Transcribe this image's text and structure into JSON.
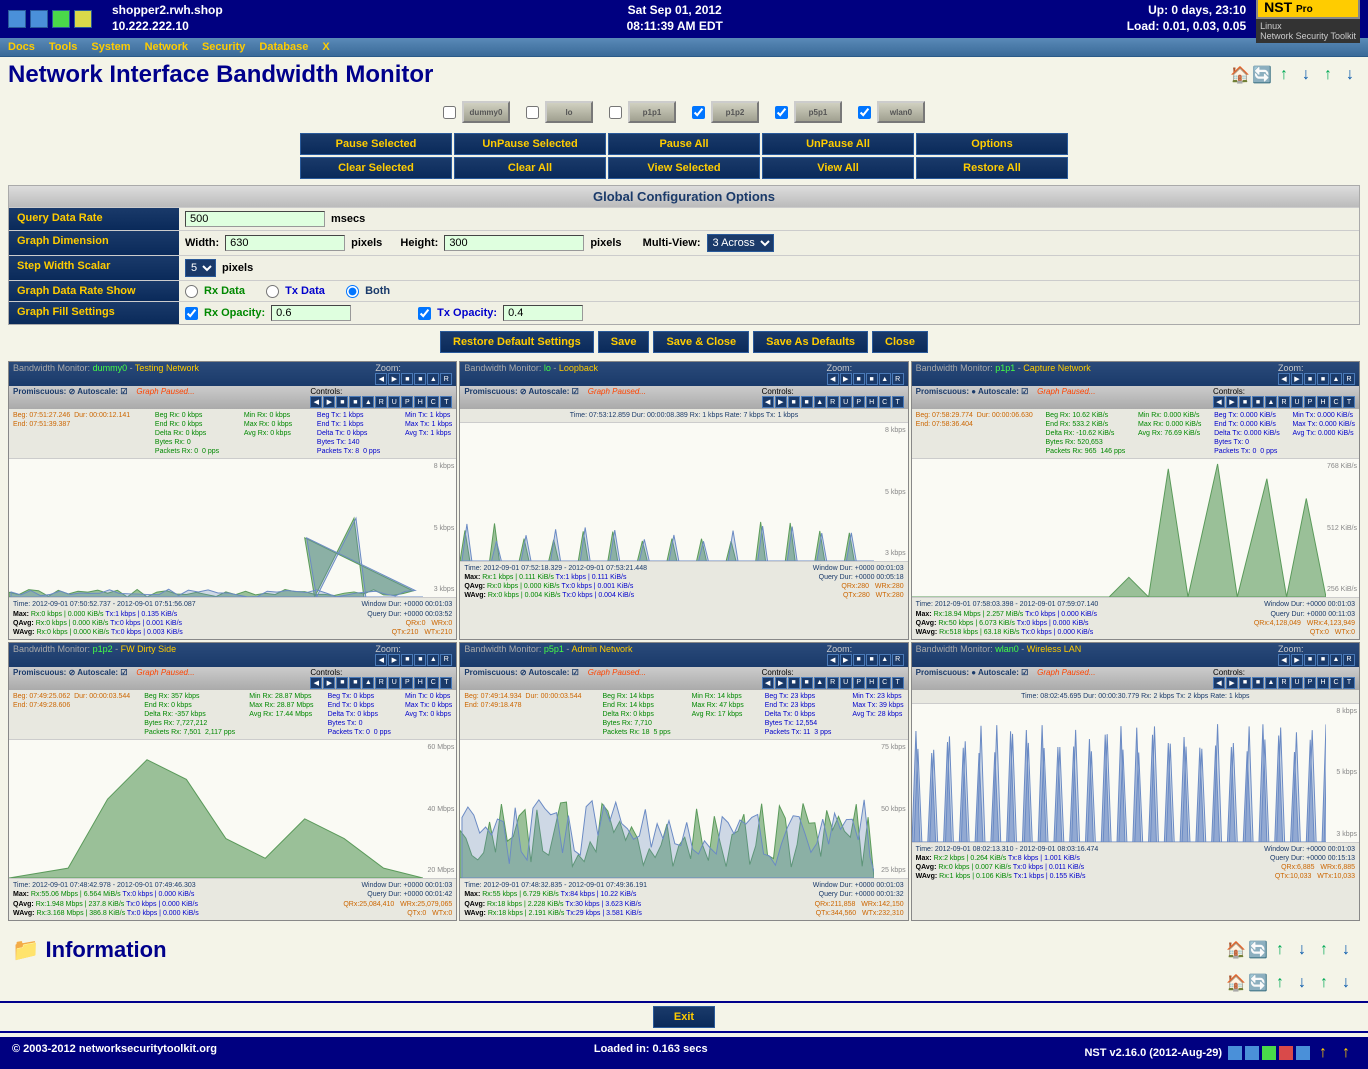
{
  "header": {
    "hostname": "shopper2.rwh.shop",
    "ip": "10.222.222.10",
    "date": "Sat Sep 01, 2012",
    "time": "08:11:39 AM EDT",
    "uptime": "Up: 0 days, 23:10",
    "load": "Load: 0.01, 0.03, 0.05",
    "logo": "NST",
    "logo_sub": "Pro",
    "os": "Linux",
    "os_sub": "Network Security Toolkit"
  },
  "menu": [
    "Docs",
    "Tools",
    "System",
    "Network",
    "Security",
    "Database",
    "X"
  ],
  "page_title": "Network Interface Bandwidth Monitor",
  "interfaces": [
    {
      "name": "dummy0",
      "checked": false
    },
    {
      "name": "lo",
      "checked": false
    },
    {
      "name": "p1p1",
      "checked": false
    },
    {
      "name": "p1p2",
      "checked": true
    },
    {
      "name": "p5p1",
      "checked": true
    },
    {
      "name": "wlan0",
      "checked": true
    }
  ],
  "action_buttons": {
    "row1": [
      "Pause Selected",
      "UnPause Selected",
      "Pause All",
      "UnPause All",
      "Options"
    ],
    "row2": [
      "Clear Selected",
      "Clear All",
      "View Selected",
      "View All",
      "Restore All"
    ]
  },
  "config": {
    "title": "Global Configuration Options",
    "query_label": "Query Data Rate",
    "query_value": "500",
    "query_unit": "msecs",
    "dimension_label": "Graph Dimension",
    "width_label": "Width:",
    "width_value": "630",
    "height_label": "Height:",
    "height_value": "300",
    "pixels": "pixels",
    "multiview_label": "Multi-View:",
    "multiview_value": "3 Across",
    "stepwidth_label": "Step Width Scalar",
    "stepwidth_value": "5",
    "datarate_label": "Graph Data Rate Show",
    "rx_data": "Rx Data",
    "tx_data": "Tx Data",
    "both": "Both",
    "fill_label": "Graph Fill Settings",
    "rx_opacity_label": "Rx Opacity:",
    "rx_opacity_value": "0.6",
    "tx_opacity_label": "Tx Opacity:",
    "tx_opacity_value": "0.4",
    "buttons": [
      "Restore Default Settings",
      "Save",
      "Save & Close",
      "Save As Defaults",
      "Close"
    ]
  },
  "graphs": [
    {
      "title_prefix": "Bandwidth Monitor:",
      "iface": "dummy0",
      "desc": "Testing Network",
      "zoom": "Zoom:",
      "promisc": "Promiscuous: ⊘  Autoscale: ☑",
      "paused": "Graph Paused...",
      "controls": "Controls:",
      "top_left": "Beg: 07:51:27.246  Dur: 00:00:12.141\nEnd: 07:51:39.387",
      "top_mid": "Beg Rx: 0 kbps\nEnd Rx: 0 kbps\nDelta Rx: 0 kbps\nBytes Rx: 0\nPackets Rx: 0  0 pps",
      "top_mid2": "Min Rx: 0 kbps\nMax Rx: 0 kbps\nAvg Rx: 0 kbps",
      "top_right": "Beg Tx: 1 kbps\nEnd Tx: 1 kbps\nDelta Tx: 0 kbps\nBytes Tx: 140\nPackets Tx: 8  0 pps",
      "top_right2": "Min Tx: 1 kbps\nMax Tx: 1 kbps\nAvg Tx: 1 kbps",
      "ylabels": [
        "8 kbps",
        "5 kbps",
        "3 kbps"
      ],
      "bottom": {
        "time": "Time: 2012-09-01 07:50:52.737  -  2012-09-01 07:51:56.087",
        "windur": "Window Dur: +0000 00:01:03",
        "max": "Max:  Rx:0 kbps | 0.000 KiB/s     Tx:1 kbps | 0.135 KiB/s",
        "qdur": "Query Dur: +0000 00:03:52",
        "qavg": "QAvg: Rx:0 kbps | 0.000 KiB/s     Tx:0 kbps | 0.001 KiB/s",
        "qrx": "QRx:0",
        "wrx": "WRx:0",
        "wavg": "WAvg: Rx:0 kbps | 0.000 KiB/s     Tx:0 kbps | 0.003 KiB/s",
        "qtx": "QTx:210",
        "wtx": "WTx:210"
      },
      "chart_data": {
        "type": "area",
        "pattern": "spikes-small",
        "rx_peak": 5,
        "tx_peak": 8
      }
    },
    {
      "title_prefix": "Bandwidth Monitor:",
      "iface": "lo",
      "desc": "Loopback",
      "zoom": "Zoom:",
      "promisc": "Promiscuous: ⊘  Autoscale: ☑",
      "paused": "Graph Paused...",
      "controls": "Controls:",
      "top_single": "Time: 07:53:12.859     Dur: 00:00:08.389     Rx: 1 kbps     Rate: 7 kbps     Tx: 1 kbps",
      "ylabels": [
        "8 kbps",
        "5 kbps",
        "3 kbps"
      ],
      "bottom": {
        "time": "Time: 2012-09-01 07:52:18.329  -  2012-09-01 07:53:21.448",
        "windur": "Window Dur: +0000 00:01:03",
        "max": "Max:  Rx:1 kbps | 0.111 KiB/s     Tx:1 kbps | 0.111 KiB/s",
        "qdur": "Query Dur: +0000 00:05:18",
        "qavg": "QAvg: Rx:0 kbps | 0.000 KiB/s     Tx:0 kbps | 0.001 KiB/s",
        "qrx": "QRx:280",
        "wrx": "WRx:280",
        "wavg": "WAvg: Rx:0 kbps | 0.004 KiB/s     Tx:0 kbps | 0.004 KiB/s",
        "qtx": "QTx:280",
        "wtx": "WTx:280"
      },
      "chart_data": {
        "type": "area",
        "pattern": "spikes-periodic",
        "rx_peak": 3,
        "tx_peak": 3
      }
    },
    {
      "title_prefix": "Bandwidth Monitor:",
      "iface": "p1p1",
      "desc": "Capture Network",
      "zoom": "Zoom:",
      "promisc": "Promiscuous: ●  Autoscale: ☑",
      "paused": "Graph Paused...",
      "controls": "Controls:",
      "top_left": "Beg: 07:58:29.774  Dur: 00:00:06.630\nEnd: 07:58:36.404",
      "top_mid": "Beg Rx: 10.62 KiB/s\nEnd Rx: 533.2 KiB/s\nDelta Rx: -10.62 KiB/s\nBytes Rx: 520,653\nPackets Rx: 965  146 pps",
      "top_mid2": "Min Rx: 0.000 KiB/s\nMax Rx: 0.000 KiB/s\nAvg Rx: 76.69 KiB/s",
      "top_right": "Beg Tx: 0.000 KiB/s\nEnd Tx: 0.000 KiB/s\nDelta Tx: 0.000 KiB/s\nBytes Tx: 0\nPackets Tx: 0  0 pps",
      "top_right2": "Min Tx: 0.000 KiB/s\nMax Tx: 0.000 KiB/s\nAvg Tx: 0.000 KiB/s",
      "ylabels": [
        "768 KiB/s",
        "512 KiB/s",
        "256 KiB/s"
      ],
      "bottom": {
        "time": "Time: 2012-09-01 07:58:03.398  -  2012-09-01 07:59:07.140",
        "windur": "Window Dur: +0000 00:01:03",
        "max": "Max:  Rx:18.94 Mbps | 2.257 MiB/s  Tx:0 kbps | 0.000 KiB/s",
        "qdur": "Query Dur: +0000 00:11:03",
        "qavg": "QAvg: Rx:50 kbps | 6.073 KiB/s     Tx:0 kbps | 0.000 KiB/s",
        "qrx": "QRx:4,128,049",
        "wrx": "WRx:4,123,949",
        "wavg": "WAvg: Rx:518 kbps | 63.18 KiB/s     Tx:0 kbps | 0.000 KiB/s",
        "qtx": "QTx:0",
        "wtx": "WTx:0"
      },
      "chart_data": {
        "type": "area",
        "pattern": "large-peaks",
        "rx_peak": 768
      }
    },
    {
      "title_prefix": "Bandwidth Monitor:",
      "iface": "p1p2",
      "desc": "FW Dirty Side",
      "zoom": "Zoom:",
      "promisc": "Promiscuous: ⊘  Autoscale: ☑",
      "paused": "Graph Paused...",
      "controls": "Controls:",
      "top_left": "Beg: 07:49:25.062  Dur: 00:00:03.544\nEnd: 07:49:28.606",
      "top_mid": "Beg Rx: 357 kbps\nEnd Rx: 0 kbps\nDelta Rx: -357 kbps\nBytes Rx: 7,727,212\nPackets Rx: 7,501  2,117 pps",
      "top_mid2": "Min Rx: 28.87 Mbps\nMax Rx: 28.87 Mbps\nAvg Rx: 17.44 Mbps",
      "top_right": "Beg Tx: 0 kbps\nEnd Tx: 0 kbps\nDelta Tx: 0 kbps\nBytes Tx: 0\nPackets Tx: 0  0 pps",
      "top_right2": "Min Tx: 0 kbps\nMax Tx: 0 kbps\nAvg Tx: 0 kbps",
      "ylabels": [
        "60 Mbps",
        "40 Mbps",
        "20 Mbps"
      ],
      "bottom": {
        "time": "Time: 2012-09-01 07:48:42.978  -  2012-09-01 07:49:46.303",
        "windur": "Window Dur: +0000 00:01:03",
        "max": "Max:  Rx:55.06 Mbps | 6.564 MiB/s  Tx:0 kbps | 0.000 KiB/s",
        "qdur": "Query Dur: +0000 00:01:42",
        "qavg": "QAvg: Rx:1.948 Mbps | 237.8 KiB/s  Tx:0 kbps | 0.000 KiB/s",
        "qrx": "QRx:25,084,410",
        "wrx": "WRx:25,079,065",
        "wavg": "WAvg: Rx:3.168 Mbps | 386.8 KiB/s  Tx:0 kbps | 0.000 KiB/s",
        "qtx": "QTx:0",
        "wtx": "WTx:0"
      },
      "chart_data": {
        "type": "area",
        "pattern": "mountain",
        "rx_peak": 55
      }
    },
    {
      "title_prefix": "Bandwidth Monitor:",
      "iface": "p5p1",
      "desc": "Admin Network",
      "zoom": "Zoom:",
      "promisc": "Promiscuous: ⊘  Autoscale: ☑",
      "paused": "Graph Paused...",
      "controls": "Controls:",
      "top_left": "Beg: 07:49:14.934  Dur: 00:00:03.544\nEnd: 07:49:18.478",
      "top_mid": "Beg Rx: 14 kbps\nEnd Rx: 14 kbps\nDelta Rx: 0 kbps\nBytes Rx: 7,710\nPackets Rx: 18  5 pps",
      "top_mid2": "Min Rx: 14 kbps\nMax Rx: 47 kbps\nAvg Rx: 17 kbps",
      "top_right": "Beg Tx: 23 kbps\nEnd Tx: 23 kbps\nDelta Tx: 0 kbps\nBytes Tx: 12,554\nPackets Tx: 11  3 pps",
      "top_right2": "Min Tx: 23 kbps\nMax Tx: 39 kbps\nAvg Tx: 28 kbps",
      "ylabels": [
        "75 kbps",
        "50 kbps",
        "25 kbps"
      ],
      "bottom": {
        "time": "Time: 2012-09-01 07:48:32.835  -  2012-09-01 07:49:36.191",
        "windur": "Window Dur: +0000 00:01:03",
        "max": "Max:  Rx:55 kbps | 6.729 KiB/s     Tx:84 kbps | 10.22 KiB/s",
        "qdur": "Query Dur: +0000 00:01:32",
        "qavg": "QAvg: Rx:18 kbps | 2.228 KiB/s     Tx:30 kbps | 3.623 KiB/s",
        "qrx": "QRx:211,858",
        "wrx": "WRx:142,150",
        "wavg": "WAvg: Rx:18 kbps | 2.191 KiB/s     Tx:29 kbps | 3.581 KiB/s",
        "qtx": "QTx:344,560",
        "wtx": "WTx:232,310"
      },
      "chart_data": {
        "type": "area",
        "pattern": "noisy",
        "rx_peak": 55,
        "tx_peak": 84
      }
    },
    {
      "title_prefix": "Bandwidth Monitor:",
      "iface": "wlan0",
      "desc": "Wireless LAN",
      "zoom": "Zoom:",
      "promisc": "Promiscuous: ●  Autoscale: ☑",
      "paused": "Graph Paused...",
      "controls": "Controls:",
      "top_single": "Time: 08:02:45.695     Dur: 00:00:30.779     Rx: 2 kbps     Tx: 2 kbps     Rate: 1 kbps",
      "ylabels": [
        "8 kbps",
        "5 kbps",
        "3 kbps"
      ],
      "bottom": {
        "time": "Time: 2012-09-01 08:02:13.310  -  2012-09-01 08:03:16.474",
        "windur": "Window Dur: +0000 00:01:03",
        "max": "Max:  Rx:2 kbps | 0.264 KiB/s     Tx:8 kbps | 1.001 KiB/s",
        "qdur": "Query Dur: +0000 00:15:13",
        "qavg": "QAvg: Rx:0 kbps | 0.007 KiB/s     Tx:0 kbps | 0.011 KiB/s",
        "qrx": "QRx:6,885",
        "wrx": "WRx:6,885",
        "wavg": "WAvg: Rx:1 kbps | 0.106 KiB/s     Tx:1 kbps | 0.155 KiB/s",
        "qtx": "QTx:10,033",
        "wtx": "WTx:10,033"
      },
      "chart_data": {
        "type": "area",
        "pattern": "regular-spikes",
        "rx_peak": 2,
        "tx_peak": 8
      }
    }
  ],
  "info_title": "Information",
  "exit": "Exit",
  "footer": {
    "copyright": "© 2003-2012 networksecuritytoolkit.org",
    "loaded": "Loaded in: 0.163 secs",
    "version": "NST v2.16.0 (2012-Aug-29)"
  }
}
